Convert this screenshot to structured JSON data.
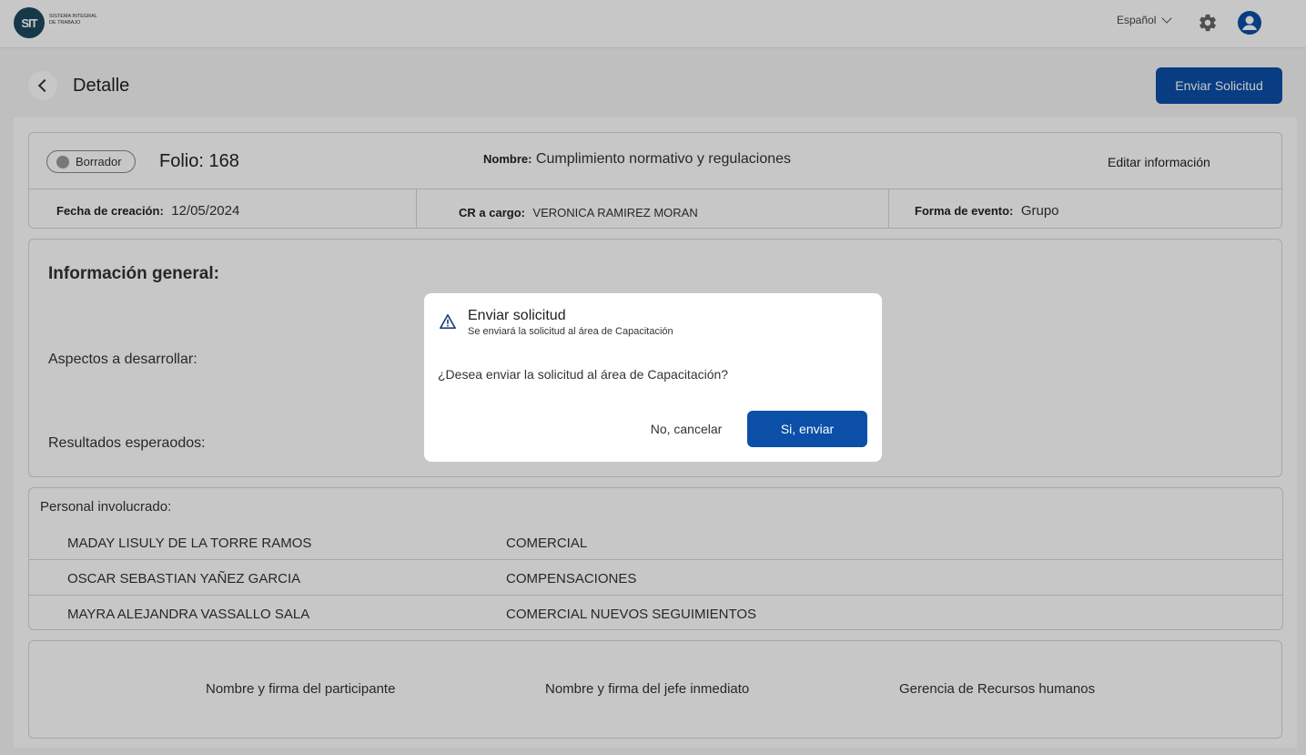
{
  "header": {
    "logo_text": "SIT",
    "logo_subtitle": "SISTEMA INTEGRAL DE TRABAJO",
    "language": "Español"
  },
  "page": {
    "title": "Detalle",
    "send_button": "Enviar Solicitud"
  },
  "summary": {
    "status": "Borrador",
    "folio": "Folio: 168",
    "name_label": "Nombre:",
    "name_value": "Cumplimiento normativo y regulaciones",
    "edit_link": "Editar información",
    "created_label": "Fecha de creación:",
    "created_value": "12/05/2024",
    "cr_label": "CR a cargo:",
    "cr_value": "VERONICA RAMIREZ MORAN",
    "event_label": "Forma de evento:",
    "event_value": "Grupo"
  },
  "general": {
    "title": "Información general:",
    "aspects_label": "Aspectos a desarrollar:",
    "results_label": "Resultados esperaodos:"
  },
  "personnel": {
    "title": "Personal involucrado:",
    "rows": [
      {
        "name": "MADAY LISULY DE LA TORRE RAMOS",
        "area": "COMERCIAL"
      },
      {
        "name": "OSCAR SEBASTIAN YAÑEZ GARCIA",
        "area": "COMPENSACIONES"
      },
      {
        "name": "MAYRA ALEJANDRA VASSALLO SALA",
        "area": "COMERCIAL NUEVOS SEGUIMIENTOS"
      }
    ]
  },
  "signatures": {
    "participant": "Nombre y firma del participante",
    "boss": "Nombre y firma del jefe inmediato",
    "hr": "Gerencia de Recursos humanos"
  },
  "modal": {
    "title": "Enviar solicitud",
    "subtitle": "Se enviará la solicitud al área de Capacitación",
    "question": "¿Desea enviar la solicitud al área de Capacitación?",
    "cancel": "No, cancelar",
    "confirm": "Si, enviar"
  },
  "colors": {
    "primary": "#0b4fa8",
    "logo": "#1d4a5e"
  }
}
